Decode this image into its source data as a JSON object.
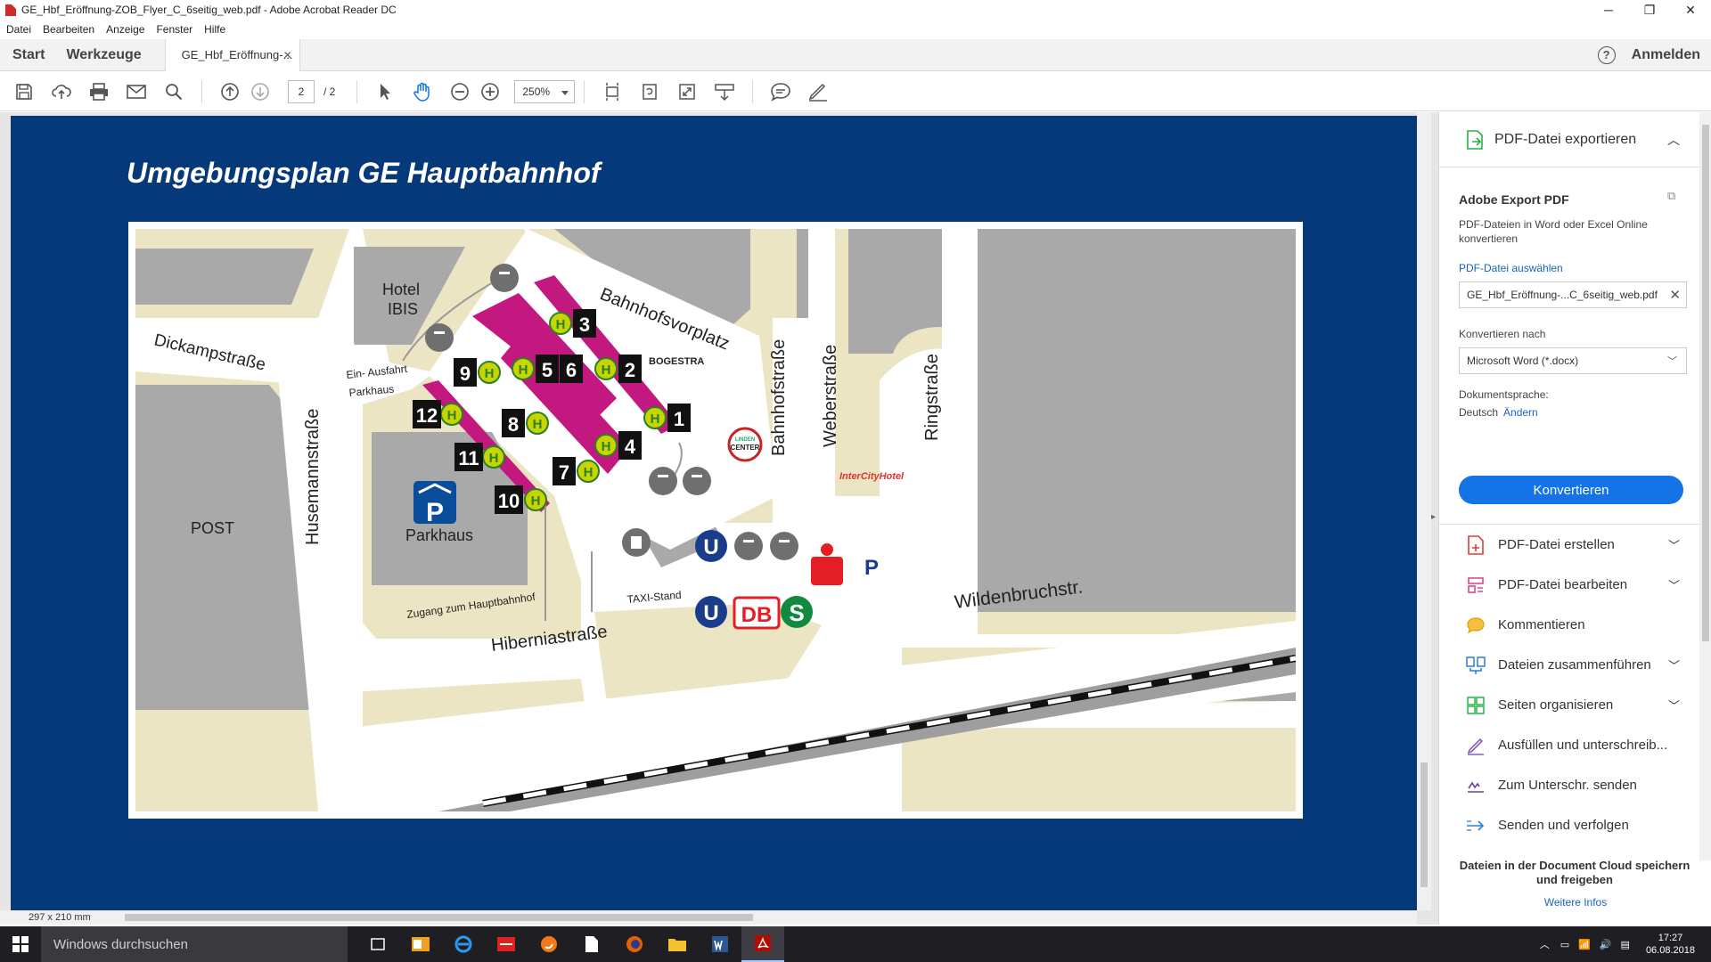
{
  "window": {
    "title": "GE_Hbf_Eröffnung-ZOB_Flyer_C_6seitig_web.pdf - Adobe Acrobat Reader DC",
    "minimize": "─",
    "maximize": "❐",
    "close": "✕"
  },
  "menu": [
    "Datei",
    "Bearbeiten",
    "Anzeige",
    "Fenster",
    "Hilfe"
  ],
  "tabs": {
    "home": "Start",
    "tools": "Werkzeuge",
    "document": "GE_Hbf_Eröffnung-...",
    "close": "✕",
    "help": "?",
    "signin": "Anmelden"
  },
  "toolbar": {
    "page_current": "2",
    "page_total": "/  2",
    "zoom": "250%"
  },
  "document": {
    "title": "Umgebungsplan GE Hauptbahnhof",
    "page_size": "297 x 210 mm",
    "map": {
      "streets": {
        "dickamp": "Dickampstraße",
        "husemann": "Husemannstraße",
        "hibernia": "Hiberniastraße",
        "bahnhofsvorplatz": "Bahnhofsvorplatz",
        "bahnhof": "Bahnhofstraße",
        "weber": "Weberstraße",
        "ring": "Ringstraße",
        "wildenbruch": "Wildenbruchstr."
      },
      "places": {
        "hotel1": "Hotel",
        "hotel2": "IBIS",
        "post": "POST",
        "parkhaus": "Parkhaus",
        "einfahrt": "Ein- Ausfahrt",
        "einfahrt2": "Parkhaus",
        "zugang": "Zugang zum Hauptbahnhof",
        "taxi": "TAXI-Stand",
        "bogestra": "BOGESTRA",
        "center1": "LINDEN",
        "center2": "CENTER",
        "intercity": "InterCityHotel",
        "parking_p": "P",
        "db": "DB",
        "u": "U",
        "s": "S",
        "h": "H"
      },
      "stops": [
        "1",
        "2",
        "3",
        "4",
        "5",
        "6",
        "7",
        "8",
        "9",
        "10",
        "11",
        "12"
      ]
    }
  },
  "panel": {
    "export_header": "PDF-Datei exportieren",
    "export_title": "Adobe Export PDF",
    "export_desc": "PDF-Dateien in Word oder Excel Online konvertieren",
    "select_file": "PDF-Datei auswählen",
    "file_name": "GE_Hbf_Eröffnung-...C_6seitig_web.pdf",
    "convert_to_label": "Konvertieren nach",
    "convert_to_value": "Microsoft Word (*.docx)",
    "doc_lang_label": "Dokumentsprache:",
    "doc_lang_value": "Deutsch",
    "doc_lang_change": "Ändern",
    "convert_button": "Konvertieren",
    "tools": [
      {
        "label": "PDF-Datei erstellen",
        "color": "#e03c3c"
      },
      {
        "label": "PDF-Datei bearbeiten",
        "color": "#e0468a"
      },
      {
        "label": "Kommentieren",
        "color": "#f5b400"
      },
      {
        "label": "Dateien zusammenführen",
        "color": "#2b7cd3"
      },
      {
        "label": "Seiten organisieren",
        "color": "#2bb14a"
      },
      {
        "label": "Ausfüllen und unterschreib...",
        "color": "#8a5cc7"
      },
      {
        "label": "Zum Unterschr. senden",
        "color": "#6b3fa0"
      },
      {
        "label": "Senden und verfolgen",
        "color": "#2b7cd3"
      }
    ],
    "cloud_text": "Dateien in der Document Cloud speichern und freigeben",
    "cloud_link": "Weitere Infos"
  },
  "taskbar": {
    "search": "Windows durchsuchen",
    "time": "17:27",
    "date": "06.08.2018"
  }
}
